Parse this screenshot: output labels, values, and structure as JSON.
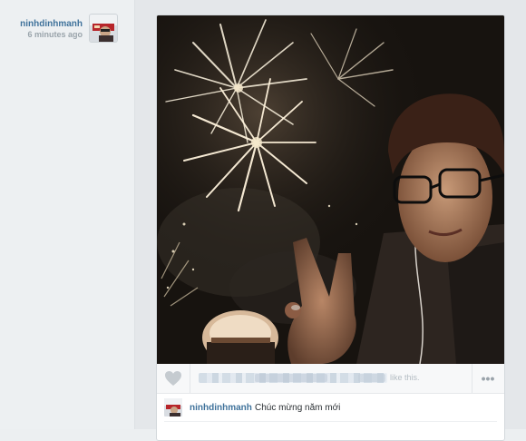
{
  "post": {
    "author": "ninhdinhmanh",
    "time_ago": "6 minutes ago",
    "like_suffix": "like this.",
    "more_label": "•••",
    "caption": {
      "user": "ninhdinhmanh",
      "text": "Chúc mừng năm mới"
    }
  },
  "icons": {
    "like": "heart-icon",
    "more": "more-dots-icon"
  },
  "colors": {
    "link_blue": "#3f729b",
    "muted_text": "#9aa4ab",
    "page_bg": "#eceff1",
    "card_bg": "#ffffff"
  }
}
